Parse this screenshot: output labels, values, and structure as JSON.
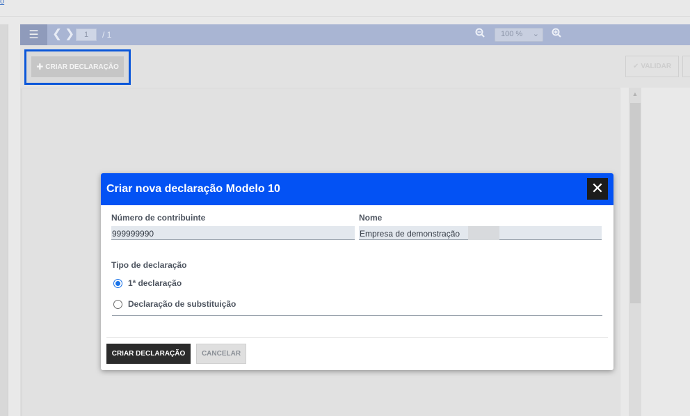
{
  "top": {
    "edge_link": "o"
  },
  "viewer": {
    "current_page": "1",
    "page_total": "/ 1",
    "zoom_value": "100 %",
    "icons": {
      "menu": "hamburger-icon",
      "prev": "chevron-left-icon",
      "next": "chevron-right-icon",
      "zoom_out": "zoom-out-icon",
      "zoom_in": "zoom-in-icon",
      "dropdown": "chevron-down-icon"
    }
  },
  "actions": {
    "create_label": "CRIAR DECLARAÇÃO",
    "create_icon": "plus-icon",
    "validate_label": "VALIDAR",
    "validate_icon": "check-icon"
  },
  "modal": {
    "title": "Criar nova declaração Modelo 10",
    "close_icon": "close-icon",
    "taxpayer_label": "Número de contribuinte",
    "taxpayer_value": "999999990",
    "name_label": "Nome",
    "name_value": "Empresa de demonstração",
    "type_label": "Tipo de declaração",
    "options": [
      {
        "label": "1ª declaração",
        "checked": true
      },
      {
        "label": "Declaração de substituição",
        "checked": false
      }
    ],
    "submit_label": "CRIAR DECLARAÇÃO",
    "cancel_label": "CANCELAR"
  },
  "colors": {
    "modal_header": "#0352f4",
    "highlight_border": "#0b57d9",
    "primary_button": "#2b2b2b",
    "toolbar": "#a9b5d3"
  }
}
